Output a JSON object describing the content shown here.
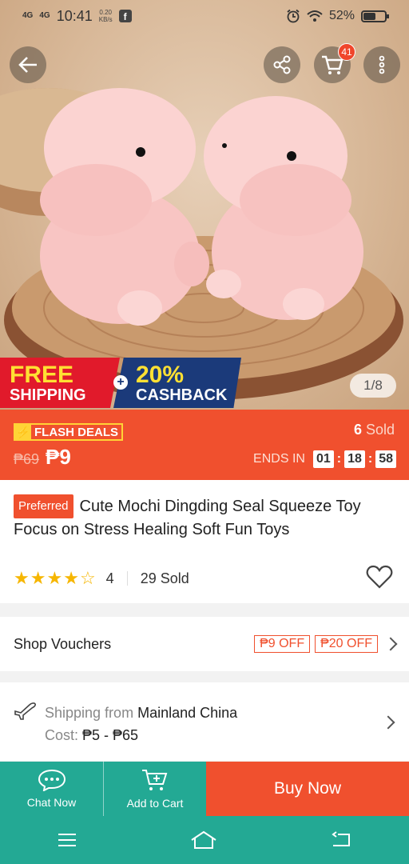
{
  "status_bar": {
    "signal1": "4G",
    "signal2": "4G",
    "time": "10:41",
    "net_speed": "0.20",
    "net_unit": "KB/s",
    "battery": "52%"
  },
  "top_nav": {
    "cart_badge": "41"
  },
  "promo": {
    "free_l1": "FREE",
    "free_l2": "SHIPPING",
    "cash_l1": "20%",
    "cash_l2": "CASHBACK"
  },
  "gallery": {
    "pager": "1/8"
  },
  "flash": {
    "tag": "FLASH DEALS",
    "sold_count": "6",
    "sold_label": "Sold",
    "old_price": "₱69",
    "price": "₱9",
    "ends_label": "ENDS IN",
    "hh": "01",
    "mm": "18",
    "ss": "58"
  },
  "product": {
    "badge": "Preferred",
    "title": "Cute Mochi Dingding Seal Squeeze Toy Focus on Stress Healing Soft Fun Toys",
    "rating": "4",
    "rating_stars": 4,
    "sold": "29 Sold"
  },
  "vouchers": {
    "label": "Shop Vouchers",
    "items": [
      "₱9 OFF",
      "₱20 OFF"
    ]
  },
  "shipping": {
    "from_label": "Shipping from",
    "from_value": "Mainland China",
    "cost_label": "Cost:",
    "cost_value": "₱5 - ₱65"
  },
  "actions": {
    "chat": "Chat Now",
    "cart": "Add to Cart",
    "buy": "Buy Now"
  },
  "colors": {
    "accent": "#f0502e",
    "teal": "#23a994",
    "star": "#f6b600"
  }
}
